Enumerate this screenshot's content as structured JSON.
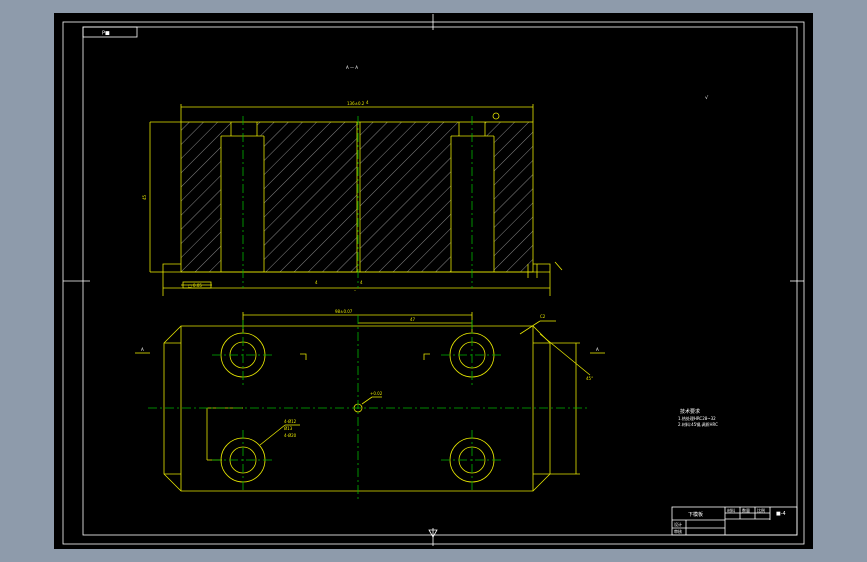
{
  "drawing": {
    "colors": {
      "background": "#8e9bab",
      "paper": "#000000",
      "frame": "#ffffff",
      "outline": "#e6e600",
      "centerline": "#00b300",
      "hatch": "#b0b0b0"
    },
    "sheet_tag": "P■",
    "section_label": "A — A",
    "roughness_label": "√",
    "top_dim": "136±0.2",
    "top_dim_note": "4",
    "side_dim": "45",
    "bottom_dims": [
      "4",
      "–",
      "4"
    ],
    "tolerance_box": "□ 0.05",
    "plan_dims": {
      "hole_span": "98±0.07",
      "half_span": "47",
      "chamfer": "C2",
      "chamfer_note": "45°",
      "center_note": "+0.02",
      "hole_note_1": "4-Ø12",
      "hole_note_2": "Ø13",
      "hole_note_3": "4-Ø20"
    },
    "section_marks": [
      "A",
      "A"
    ],
    "tech_notes": {
      "title": "技术要求",
      "line1": "1.热处理HRC28~32",
      "line2": "2.材料:45钢,调质HRC"
    },
    "title_block": {
      "part_name": "下模板",
      "material_hdr": "材料",
      "qty_hdr": "数量",
      "scale_hdr": "比例",
      "drawing_no": "图号",
      "designer": "设计",
      "reviewer": "审核",
      "sheet_no": "■-4"
    }
  }
}
